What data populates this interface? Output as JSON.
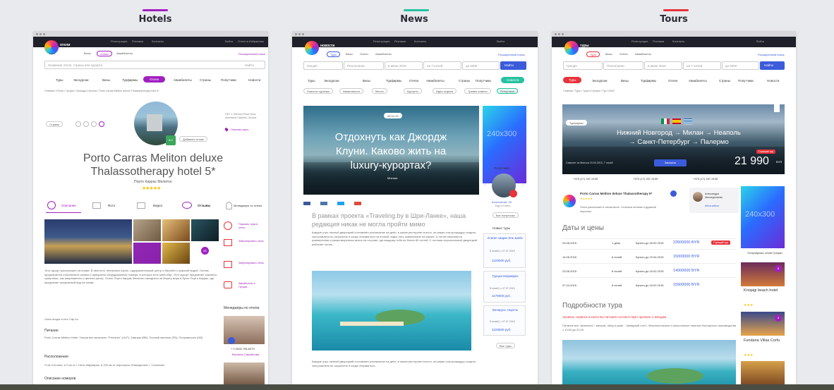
{
  "sections": [
    {
      "title": "Hotels",
      "color": "#a020c0"
    },
    {
      "title": "News",
      "color": "#25c2a0"
    },
    {
      "title": "Tours",
      "color": "#e8323c"
    }
  ],
  "hotels": {
    "logo_text": "отели",
    "tabs": [
      "Туры",
      "Визы",
      "Отели",
      "Авиабилеты"
    ],
    "ext_search": "Расширенный поиск",
    "search_placeholder": "Название отеля, страны или курорта",
    "search_btn": "Найти",
    "nav": [
      "Туры",
      "Экскурсии",
      "Визы",
      "Турфирмы",
      "Отели",
      "Авиабилеты",
      "Страны",
      "Попутчики",
      "Новости"
    ],
    "breadcrumb": "Главная / Отели / Греция / Халкиди-Ситония / Porto Carras Meliton deluxe Thalassotherapy hotel 5*",
    "back_btn": "Страны",
    "rating": "8.0",
    "add_btn": "Добавить отзыв",
    "show_map": "Показать карту",
    "address": "GR7-1 Sithonia Road Neos Marmaras Halkidiki, Греция",
    "title": "Porto Carras Meliton deluxe Thalassotherapy hotel 5*",
    "subtitle": "Порто Каррас Мелитон",
    "tab_labels": [
      "Описание",
      "Фото",
      "Видео",
      "Отзывы",
      "Менеджеры по отелю"
    ],
    "actions": [
      "Показать туры в отель",
      "Забронировать отель",
      "Забронировать отель",
      "Авиабилеты в Грецию"
    ],
    "photo_badge": "65",
    "description": "Этот курорт расположен на пляже. В нём есть теннисные корты, оздоровительный центр и бассейн с морской водой. Гостям предлагается собственное казино и прекрасно оборудованные номера, в которых есть мини-бар. Этот курорт предлагает комнаты-суперлюкс, как апартаменты и фитнес-центр. Отель Порто Каррас Мелитон находится на берегу моря в бухте Порто Каррас, где предлагает прекрасный вид на залив.",
    "source": "Отель входит в сеть Tulip Inn",
    "food_h": "Питание",
    "food": "Porto Carras Meliton Hotel: Ультра все включено \"Premium\" (ULP), Завтрак (BB), Полный пансион (FB), Полупансион (HB)",
    "loc_h": "Расположение",
    "loc": "П-ов Ситония, в 2 км от г. Неос Мармарас, в 105 км от аэропорта «Македония» г. Салоники.",
    "rooms_h": "Описание номеров",
    "managers_h": "Менеджеры по отелю:",
    "manager_phone": "+ 0 0535 798-8379",
    "manager_name": "Виталия Самойлова"
  },
  "news": {
    "logo_text": "новости",
    "tabs": [
      "Туры",
      "Визы",
      "Отели",
      "Авиабилеты"
    ],
    "ext_search": "Расширенный поиск",
    "filters": [
      "Греция",
      "Пелопоннес",
      "в июне 2015",
      "на 7 ночей",
      "до 5000"
    ],
    "search_btn": "Найти",
    "nav": [
      "Туры",
      "Экскурсии",
      "Визы",
      "Турфирмы",
      "Отели",
      "Авиабилеты",
      "Страны",
      "Попутчики"
    ],
    "news_btn": "Новости",
    "chips": [
      "Новости туризма",
      "Авиановости",
      "Места",
      "Курорты",
      "Идеи отдыха",
      "Тревел-советы",
      "Репортажи"
    ],
    "date_badge": "08.04.15",
    "headline": "Отдохнуть как Джордж Клуни. Каково жить на luxury-курортах?",
    "tag": "Мнения",
    "ad": "240x300",
    "companions_h": "Попутчики",
    "companion_name": "Константин, 29",
    "companion_city": "Еду в Египет",
    "all_companions": "Все попутчики",
    "lead": "В рамках проекта «Traveling.by в Шри-Ланке», наша редакция никак не могла пройти мимо",
    "body": "Каждое утро личный дворецкий составляет расписание на день: в каком ресторане поесть, на какую спа-процедуру сходить, чем развлечь во скоролнне и когда отправиться на личной лодке пить шампанское на закате. А потом начинается размеренная и умиротворенная жизнь на острове, где каждому тебя не более 80 гостей. С гостями персональный дворецкий работает лично.",
    "body2": "Каждое утро личный дворецкий составляет расписание на день: в каком ресторане поесть, на какую спа-процедуру сходить, чем развлечь во скоролнне и когда отправиться.",
    "new_tours_h": "Новые туры",
    "tours": [
      {
        "name": "Египет Шарм-Эль-Шейх",
        "meta": "8 ночей | c 07.07.2015",
        "price": "2229000 руб."
      },
      {
        "name": "Турция Мармарис",
        "meta": "8 ночей | c 07.07.2015",
        "price": "1179000 руб."
      },
      {
        "name": "Беларусь Нарочь",
        "meta": "8 ночей | c 07.07.2015",
        "price": "2229000 руб."
      }
    ],
    "all_tours": "Все туры"
  },
  "tours": {
    "logo_text": "туры",
    "tabs": [
      "Туры",
      "Визы",
      "Отели",
      "Авиабилеты"
    ],
    "ext_search": "Расширенный поиск",
    "filters": [
      "Греция",
      "Пелопоннес",
      "в июне 2015",
      "на 7 ночей",
      "до 5000"
    ],
    "search_btn": "Найти",
    "nav": [
      "Туры",
      "Экскурсии",
      "Визы",
      "Турфирмы",
      "Отели",
      "Авиабилеты",
      "Страны",
      "Попутчики",
      "Новости"
    ],
    "breadcrumb": "Главная / Туры / Туры в Грецию / Тур 12453",
    "back_btn": "Турфирмы",
    "route1": "Нижний Новгород → Милан → Неаполь",
    "route2": "→ Санкт-Петербург → Палермо",
    "hot": "Горящий тур",
    "price": "21 990",
    "currency": "BYR",
    "dates": "Самолет из Минска 15.04.2015, 7 ночей",
    "book_btn": "Заказать",
    "phones": [
      "+375 (17) 397-9195",
      "+375 (17) 397-9195",
      "+375 (17) 397-9195"
    ],
    "hotel_name": "Porto Carras Meliton deluxe Thalassotherapy 5*",
    "hotel_desc": "Отель расположен в тихом месте. Отличное питание и дружный персонал.",
    "agent_name": "Александра Мясоедолаева",
    "agent_link": "Alexa.adtour",
    "dates_h": "Даты и цены",
    "rows": [
      {
        "date": "03.08.2015",
        "nights": "1 день",
        "buy": "Купить до 28.02.2015",
        "price": "23500000 BYR",
        "hot": "Горящий тур"
      },
      {
        "date": "14.05.2015",
        "nights": "6 ночей",
        "buy": "Купить до 23.04.2015",
        "price": "15000000 BYR",
        "hot": ""
      },
      {
        "date": "23.06.2015",
        "nights": "8 ночей",
        "buy": "Купить до 18.02.2015",
        "price": "14000000 BYR",
        "hot": ""
      },
      {
        "date": "07.04.2015",
        "nights": "8 ночей",
        "buy": "Купить до 18.02.2015",
        "price": "15500000 BYR",
        "hot": ""
      }
    ],
    "details_h": "Подробности тура",
    "details_red": "Уровень сервиса и качество питания соответствует крепкие 4 звездам",
    "details_body": "Питание все \"включено\": завтрак, обед и ужин - \"шведский стол\", безалкогольные и алкогольные напитки болгарского производства с 10:00 до 22:00",
    "ad": "240x300",
    "popular_h": "Популярные отели Греции",
    "popular": [
      {
        "name": "Kriopigi beach hotel",
        "badge": "8"
      },
      {
        "name": "Fundana Villas Corfu",
        "badge": "8"
      }
    ]
  }
}
